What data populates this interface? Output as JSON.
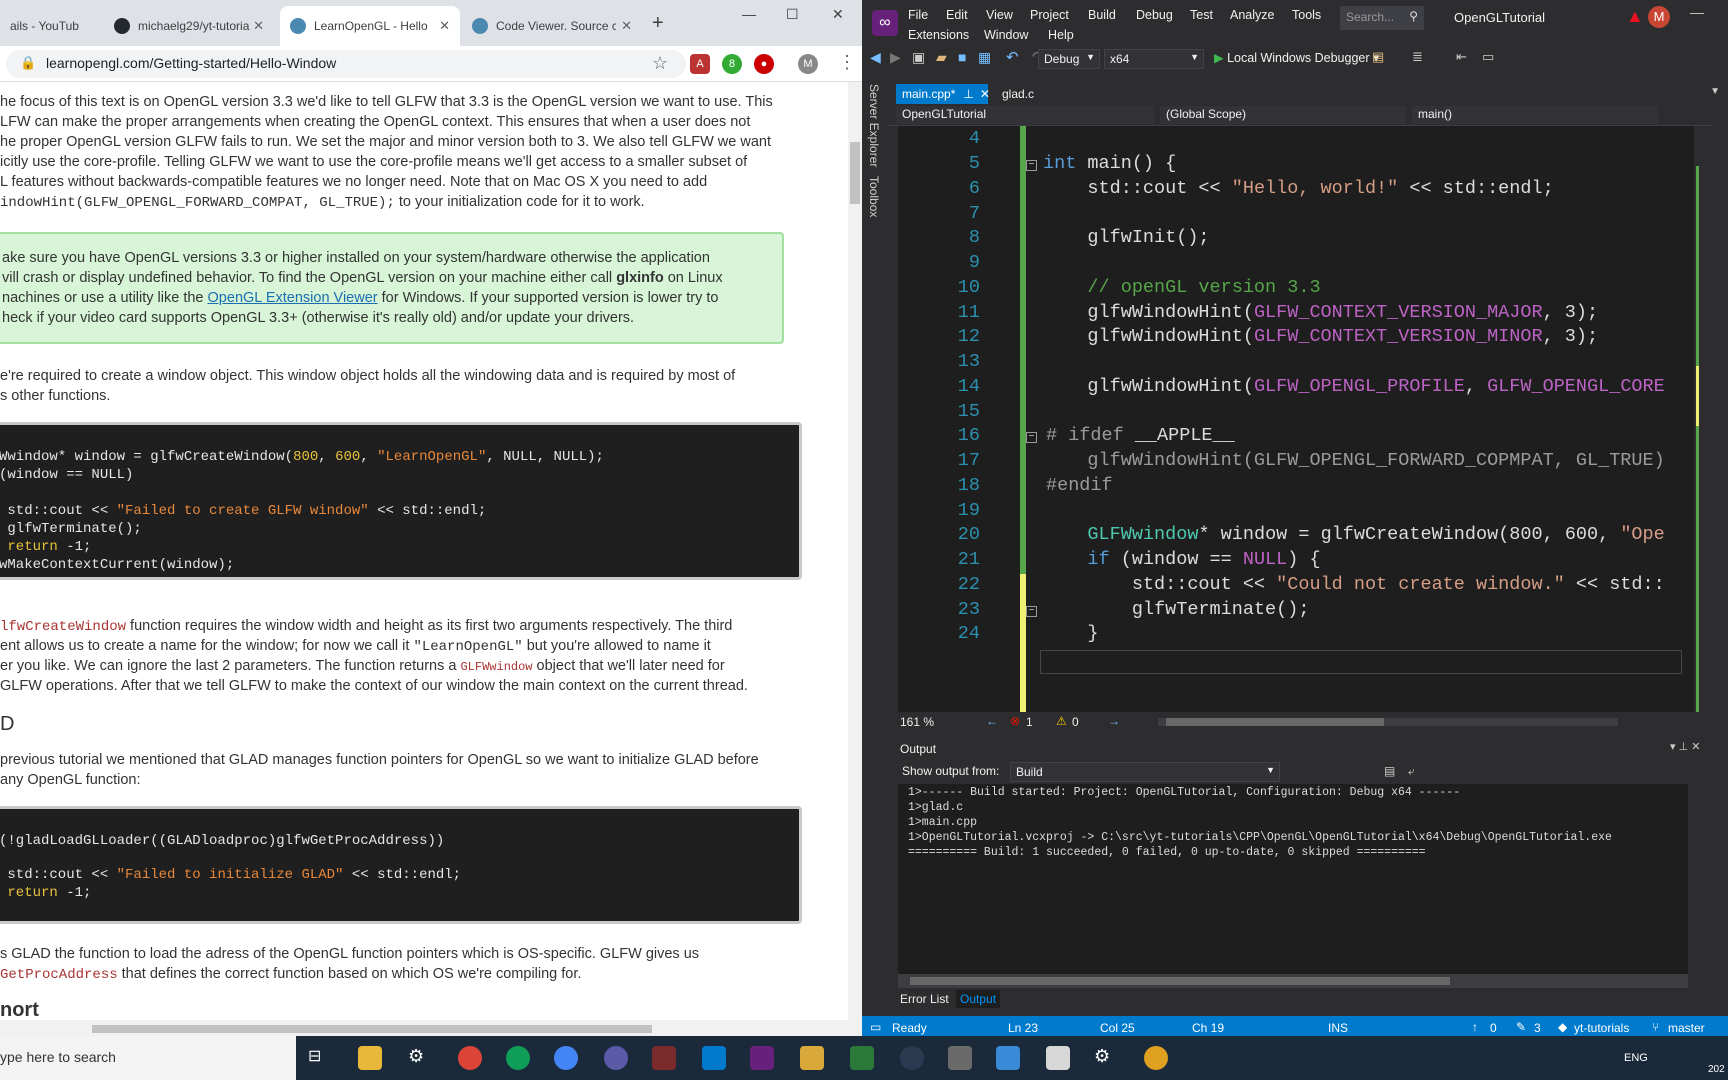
{
  "browser": {
    "tabs": [
      {
        "label": "ails - YouTub",
        "active": false
      },
      {
        "label": "michaelg29/yt-tutoria",
        "active": false
      },
      {
        "label": "LearnOpenGL - Hello",
        "active": true
      },
      {
        "label": "Code Viewer. Source c",
        "active": false
      }
    ],
    "new_tab": "+",
    "url": "learnopengl.com/Getting-started/Hello-Window",
    "window_controls": [
      "—",
      "☐",
      "✕"
    ]
  },
  "article": {
    "para1": [
      "he focus of this text is on OpenGL version 3.3 we'd like to tell GLFW that 3.3 is the OpenGL version we want to use. This",
      "LFW can make the proper arrangements when creating the OpenGL context. This ensures that when a user does not",
      "he proper OpenGL version GLFW fails to run. We set the major and minor version both to 3. We also tell GLFW we want",
      "icitly use the core-profile. Telling GLFW we want to use the core-profile means we'll get access to a smaller subset of",
      "L features without backwards-compatible features we no longer need. Note that on Mac OS X you need to add"
    ],
    "para1_code": "indowHint(GLFW_OPENGL_FORWARD_COMPAT, GL_TRUE);",
    "para1_tail": " to your initialization code for it to work.",
    "note": {
      "line1": "ake sure you have OpenGL versions 3.3 or higher installed on your system/hardware otherwise the application",
      "line2a": "vill crash or display undefined behavior. To find the OpenGL version on your machine either call ",
      "line2b": "glxinfo",
      "line2c": " on Linux",
      "line3a": "nachines or use a utility like the ",
      "line3b": "OpenGL Extension Viewer",
      "line3c": " for Windows. If your supported version is lower try to",
      "line4": "heck if your video card supports OpenGL 3.3+ (otherwise it's really old) and/or update your drivers."
    },
    "para2": [
      "e're required to create a window object. This window object holds all the windowing data and is required by most of",
      "s other functions."
    ],
    "code1": {
      "l1a": "Wwindow* window = glfwCreateWindow(",
      "l1n1": "800",
      "l1b": ", ",
      "l1n2": "600",
      "l1c": ", ",
      "l1s": "\"LearnOpenGL\"",
      "l1d": ", NULL, NULL);",
      "l2": "(window == NULL)",
      "l3a": " std::cout << ",
      "l3s": "\"Failed to create GLFW window\"",
      "l3b": " << std::endl;",
      "l4": " glfwTerminate();",
      "l5k": " return",
      "l5": " -1;",
      "l6": "wMakeContextCurrent(window);"
    },
    "para3": {
      "l1a": "lfwCreateWindow",
      "l1b": " function requires the window width and height as its first two arguments respectively. The third",
      "l2a": "ent allows us to create a name for the window; for now we call it ",
      "l2b": "\"LearnOpenGL\"",
      "l2c": " but you're allowed to name it",
      "l3": "er you like. We can ignore the last 2 parameters. The function returns a ",
      "l3b": "GLFWwindow",
      "l3c": " object that we'll later need for",
      "l4": "GLFW operations. After that we tell GLFW to make the context of our window the main context on the current thread."
    },
    "heading_frag": "D",
    "para4": [
      "previous tutorial we mentioned that GLAD manages function pointers for OpenGL so we want to initialize GLAD before",
      " any OpenGL function:"
    ],
    "code2": {
      "l1": "(!gladLoadGLLoader((GLADloadproc)glfwGetProcAddress))",
      "l2a": " std::cout << ",
      "l2s": "\"Failed to initialize GLAD\"",
      "l2b": " << std::endl;",
      "l3k": " return",
      "l3": " -1;"
    },
    "para5": {
      "l1": "s GLAD the function to load the adress of the OpenGL function pointers which is OS-specific. GLFW gives us",
      "l2a": "GetProcAddress",
      "l2b": " that defines the correct function based on which OS we're compiling for."
    },
    "heading2_frag": "nort"
  },
  "vs": {
    "menus_row1": [
      "File",
      "Edit",
      "View",
      "Project",
      "Build",
      "Debug",
      "Test",
      "Analyze",
      "Tools"
    ],
    "menus_row2": [
      "Extensions",
      "Window",
      "Help"
    ],
    "search_placeholder": "Search...",
    "solution_name": "OpenGLTutorial",
    "user_initial": "M",
    "config": "Debug",
    "platform": "x64",
    "debugger": "Local Windows Debugger",
    "side_tabs": [
      "Server Explorer",
      "Toolbox"
    ],
    "editor_tabs": [
      "main.cpp*",
      "glad.c"
    ],
    "nav": {
      "project": "OpenGLTutorial",
      "scope": "(Global Scope)",
      "member": "main()"
    },
    "lines": [
      "4",
      "5",
      "6",
      "7",
      "8",
      "9",
      "10",
      "11",
      "12",
      "13",
      "14",
      "15",
      "16",
      "17",
      "18",
      "19",
      "20",
      "21",
      "22",
      "23",
      "24"
    ],
    "code": {
      "l5a": "int",
      "l5b": " main() {",
      "l6a": "    std::cout << ",
      "l6s": "\"Hello, world!\"",
      "l6b": " << std::endl;",
      "l8": "    glfwInit();",
      "l10": "    // openGL version 3.3",
      "l11a": "    glfwWindowHint(",
      "l11m": "GLFW_CONTEXT_VERSION_MAJOR",
      "l11b": ", 3);",
      "l12a": "    glfwWindowHint(",
      "l12m": "GLFW_CONTEXT_VERSION_MINOR",
      "l12b": ", 3);",
      "l14a": "    glfwWindowHint(",
      "l14m": "GLFW_OPENGL_PROFILE",
      "l14b": ", ",
      "l14m2": "GLFW_OPENGL_CORE",
      "l16a": "# ifdef",
      "l16b": " __APPLE__",
      "l17": "    glfwWindowHint(GLFW_OPENGL_FORWARD_COPMPAT, GL_TRUE)",
      "l18": "#endif",
      "l20a": "    ",
      "l20t": "GLFWwindow",
      "l20b": "* window = glfwCreateWindow(800, 600, ",
      "l20s": "\"Ope",
      "l21a": "    ",
      "l21k": "if",
      "l21b": " (window == ",
      "l21m": "NULL",
      "l21c": ") {",
      "l22a": "        std::cout << ",
      "l22s": "\"Could not create window.\"",
      "l22b": " << std::",
      "l23": "        glfwTerminate();",
      "l24": "    }"
    },
    "zoom": "161 %",
    "errors": "1",
    "warnings": "0",
    "output_title": "Output",
    "show_output_from_label": "Show output from:",
    "show_output_from_value": "Build",
    "output_lines": [
      "1>------ Build started: Project: OpenGLTutorial, Configuration: Debug x64 ------",
      "1>glad.c",
      "1>main.cpp",
      "1>OpenGLTutorial.vcxproj -> C:\\src\\yt-tutorials\\CPP\\OpenGL\\OpenGLTutorial\\x64\\Debug\\OpenGLTutorial.exe",
      "========== Build: 1 succeeded, 0 failed, 0 up-to-date, 0 skipped =========="
    ],
    "bottom_tabs": [
      "Error List",
      "Output"
    ],
    "status": {
      "ready": "Ready",
      "ln": "Ln 23",
      "col": "Col 25",
      "ch": "Ch 19",
      "ins": "INS",
      "up": "0",
      "pencil": "3",
      "repo": "yt-tutorials",
      "branch": "master"
    }
  },
  "taskbar": {
    "search_placeholder": "ype here to search",
    "lang": "ENG",
    "time": "202"
  }
}
